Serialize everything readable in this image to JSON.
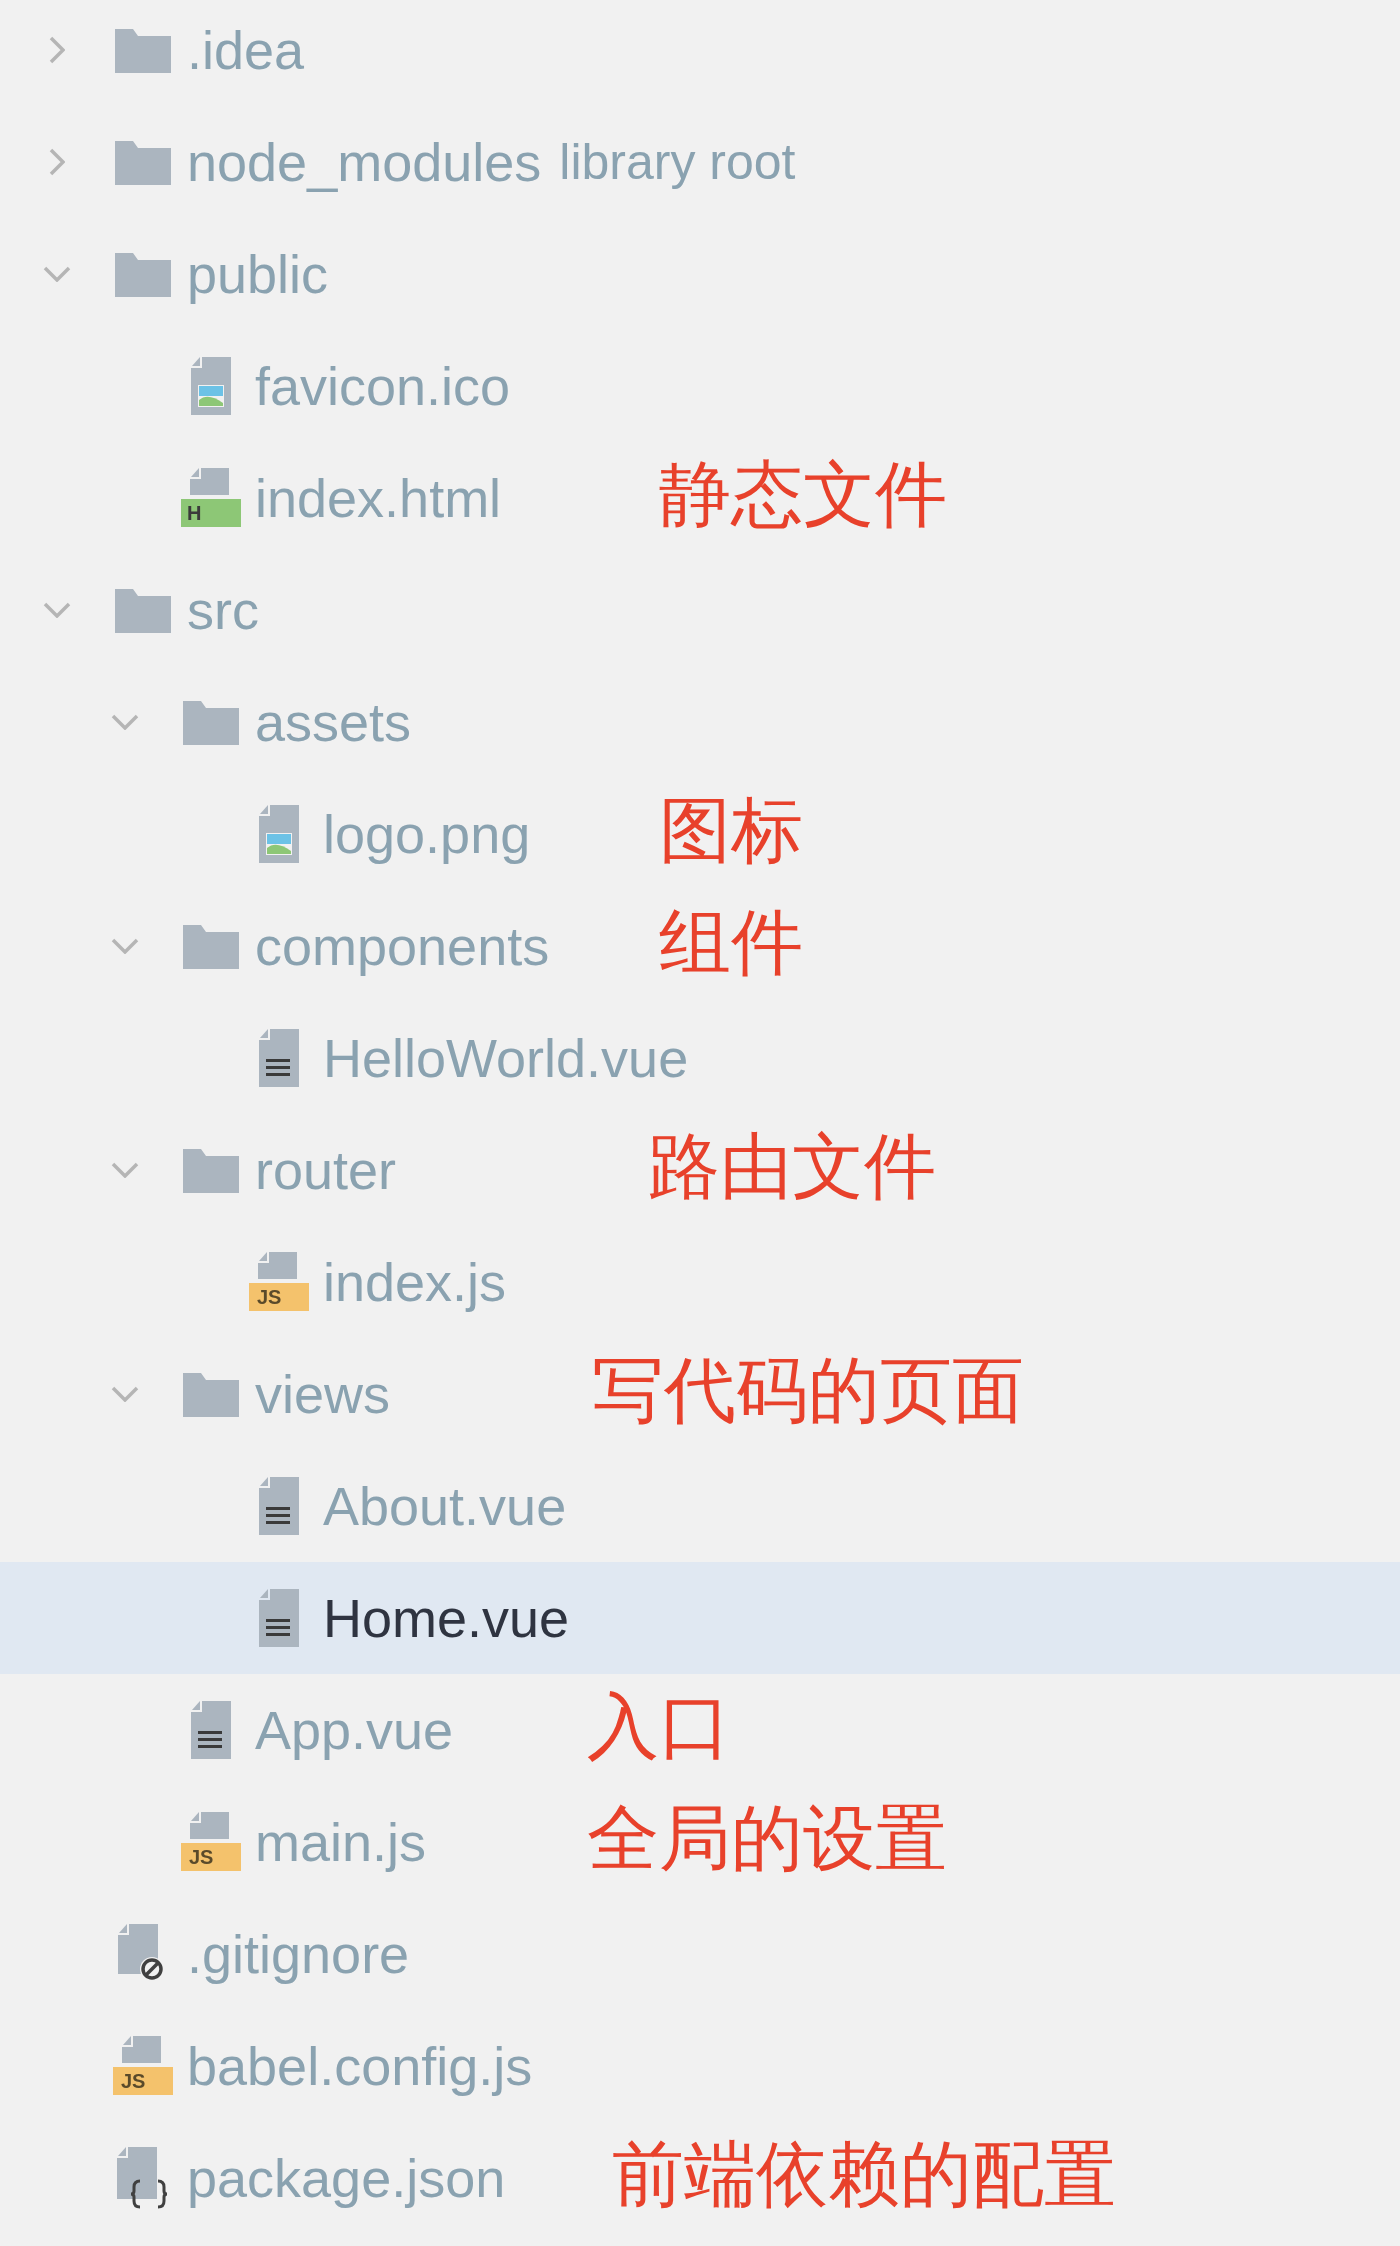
{
  "tree": [
    {
      "kind": "folder",
      "name": ".idea",
      "expanded": false,
      "selected": false
    },
    {
      "kind": "folder",
      "name": "node_modules",
      "suffix": "library root",
      "expanded": false,
      "selected": false
    },
    {
      "kind": "folder",
      "name": "public",
      "expanded": true,
      "selected": false,
      "children": [
        {
          "kind": "image",
          "name": "favicon.ico",
          "selected": false
        },
        {
          "kind": "html",
          "name": "index.html",
          "badge": "H",
          "selected": false,
          "note": "静态文件"
        }
      ]
    },
    {
      "kind": "folder",
      "name": "src",
      "expanded": true,
      "selected": false,
      "children": [
        {
          "kind": "folder",
          "name": "assets",
          "expanded": true,
          "selected": false,
          "children": [
            {
              "kind": "image",
              "name": "logo.png",
              "selected": false,
              "note": "图标"
            }
          ]
        },
        {
          "kind": "folder",
          "name": "components",
          "expanded": true,
          "selected": false,
          "note": "组件",
          "children": [
            {
              "kind": "text",
              "name": "HelloWorld.vue",
              "selected": false
            }
          ]
        },
        {
          "kind": "folder",
          "name": "router",
          "expanded": true,
          "selected": false,
          "note": "路由文件",
          "children": [
            {
              "kind": "js",
              "name": "index.js",
              "badge": "JS",
              "selected": false
            }
          ]
        },
        {
          "kind": "folder",
          "name": "views",
          "expanded": true,
          "selected": false,
          "note": "写代码的页面",
          "children": [
            {
              "kind": "text",
              "name": "About.vue",
              "selected": false
            },
            {
              "kind": "text",
              "name": "Home.vue",
              "selected": true
            }
          ]
        },
        {
          "kind": "text",
          "name": "App.vue",
          "selected": false,
          "note": "入口"
        },
        {
          "kind": "js",
          "name": "main.js",
          "badge": "JS",
          "selected": false,
          "note": "全局的设置"
        }
      ]
    },
    {
      "kind": "ignore",
      "name": ".gitignore",
      "selected": false
    },
    {
      "kind": "js",
      "name": "babel.config.js",
      "badge": "JS",
      "selected": false
    },
    {
      "kind": "json",
      "name": "package.json",
      "selected": false,
      "note": "前端依赖的配置"
    }
  ]
}
